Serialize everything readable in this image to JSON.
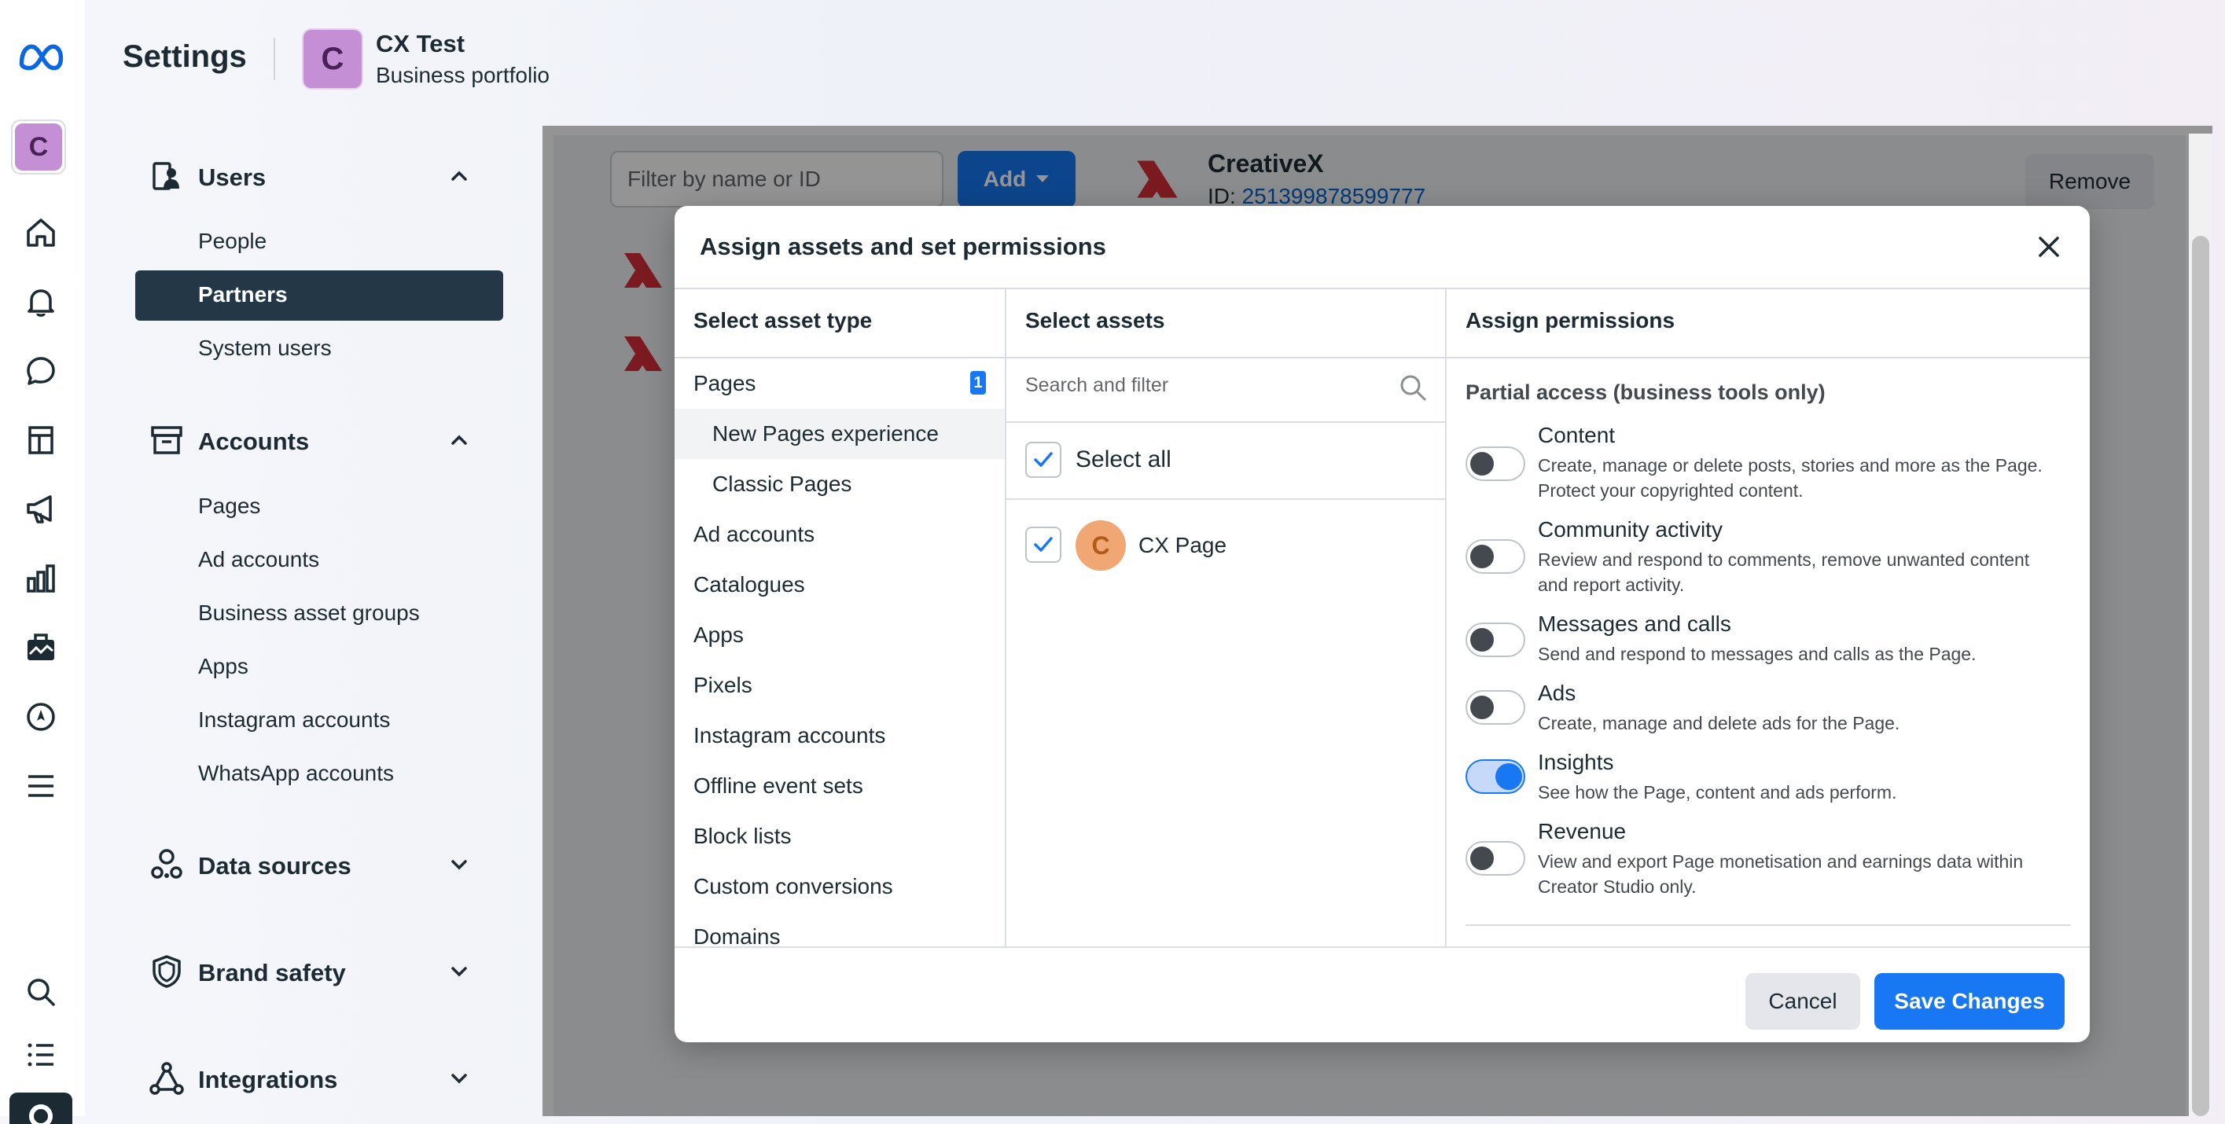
{
  "header": {
    "title": "Settings",
    "account_initial": "C",
    "account_name": "CX Test",
    "account_type": "Business portfolio"
  },
  "rail": {
    "avatar_initial": "C",
    "icons": [
      "meta-logo-icon",
      "home-icon",
      "bell-icon",
      "chat-icon",
      "pages-icon",
      "megaphone-icon",
      "bar-chart-icon",
      "briefcase-icon",
      "compass-icon",
      "menu-icon",
      "search-icon",
      "list-icon",
      "settings-icon"
    ]
  },
  "sidebar": {
    "users": {
      "label": "Users",
      "items": [
        "People",
        "Partners",
        "System users"
      ]
    },
    "accounts": {
      "label": "Accounts",
      "items": [
        "Pages",
        "Ad accounts",
        "Business asset groups",
        "Apps",
        "Instagram accounts",
        "WhatsApp accounts"
      ]
    },
    "data_sources": {
      "label": "Data sources"
    },
    "brand_safety": {
      "label": "Brand safety"
    },
    "integrations": {
      "label": "Integrations"
    }
  },
  "partners_panel": {
    "filter_placeholder": "Filter by name or ID",
    "add_label": "Add",
    "partner_name": "CreativeX",
    "id_prefix": "ID: ",
    "partner_id": "251399878599777",
    "remove_label": "Remove"
  },
  "modal": {
    "title": "Assign assets and set permissions",
    "columns": {
      "asset_type": "Select asset type",
      "assets": "Select assets",
      "permissions": "Assign permissions"
    },
    "asset_types": [
      {
        "label": "Pages",
        "badge": "1"
      },
      {
        "label": "New Pages experience"
      },
      {
        "label": "Classic Pages"
      },
      {
        "label": "Ad accounts"
      },
      {
        "label": "Catalogues"
      },
      {
        "label": "Apps"
      },
      {
        "label": "Pixels"
      },
      {
        "label": "Instagram accounts"
      },
      {
        "label": "Offline event sets"
      },
      {
        "label": "Block lists"
      },
      {
        "label": "Custom conversions"
      },
      {
        "label": "Domains"
      }
    ],
    "search_placeholder": "Search and filter",
    "select_all_label": "Select all",
    "assets": [
      {
        "initial": "C",
        "name": "CX Page",
        "checked": true
      }
    ],
    "partial_access_label": "Partial access (business tools only)",
    "permissions": [
      {
        "title": "Content",
        "desc": "Create, manage or delete posts, stories and more as the Page. Protect your copyrighted content.",
        "on": false
      },
      {
        "title": "Community activity",
        "desc": "Review and respond to comments, remove unwanted content and report activity.",
        "on": false
      },
      {
        "title": "Messages and calls",
        "desc": "Send and respond to messages and calls as the Page.",
        "on": false
      },
      {
        "title": "Ads",
        "desc": "Create, manage and delete ads for the Page.",
        "on": false
      },
      {
        "title": "Insights",
        "desc": "See how the Page, content and ads perform.",
        "on": true
      },
      {
        "title": "Revenue",
        "desc": "View and export Page monetisation and earnings data within Creator Studio only.",
        "on": false
      }
    ],
    "cancel_label": "Cancel",
    "save_label": "Save Changes"
  },
  "colors": {
    "accent": "#1877f2",
    "nav_selected": "#243746",
    "avatar": "#c58fd6",
    "page_avatar": "#f0a773"
  }
}
